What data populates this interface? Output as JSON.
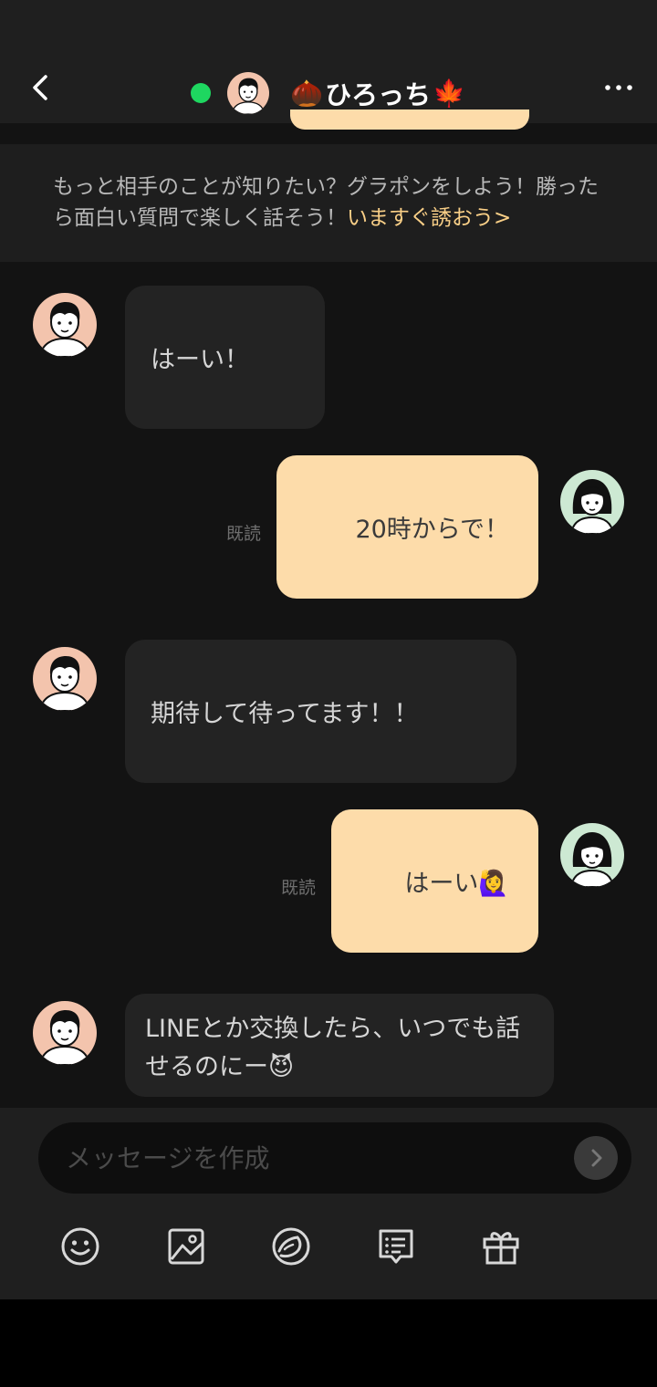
{
  "header": {
    "title_prefix_emoji": "🌰",
    "title": "ひろっち",
    "title_suffix_emoji": "🍁",
    "online_color": "#1ed760"
  },
  "banner": {
    "text": "もっと相手のことが知りたい？グラポンをしよう！勝ったら面白い質問で楽しく話そう！",
    "invite": "いますぐ誘おう>"
  },
  "messages": [
    {
      "from": "them",
      "text": "はーい！"
    },
    {
      "from": "me",
      "text": "20時からで！",
      "status": "既読"
    },
    {
      "from": "them",
      "text": "期待して待ってます！！"
    },
    {
      "from": "me",
      "text": "はーい🙋‍♀️",
      "status": "既読"
    },
    {
      "from": "them",
      "text": "LINEとか交換したら、いつでも話せるのにー😈"
    }
  ],
  "composer": {
    "placeholder": "メッセージを作成",
    "tools": [
      "emoji-icon",
      "image-icon",
      "sticker-icon",
      "template-message-icon",
      "gift-icon"
    ]
  },
  "colors": {
    "background": "#131313",
    "bubble_in": "#232323",
    "bubble_out": "#fddcaa",
    "accent": "#f9cf87"
  }
}
